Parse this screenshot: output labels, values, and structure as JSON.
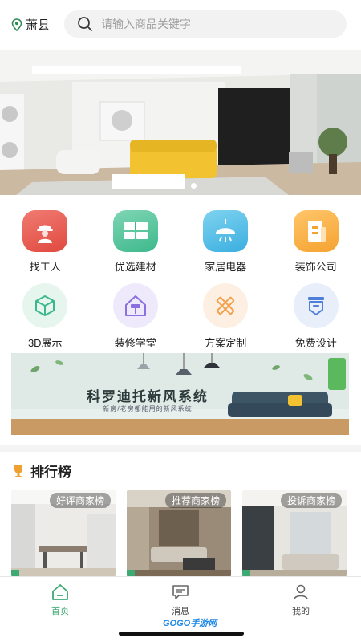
{
  "header": {
    "location": "萧县",
    "search_placeholder": "请输入商品关键字"
  },
  "banner": {
    "slides": 4,
    "active_slide": 4
  },
  "categories": [
    {
      "label": "找工人",
      "icon": "worker-icon",
      "color": "#e9564b"
    },
    {
      "label": "优选建材",
      "icon": "bricks-icon",
      "color": "#4cc097"
    },
    {
      "label": "家居电器",
      "icon": "lamp-icon",
      "color": "#45b5e3"
    },
    {
      "label": "装饰公司",
      "icon": "building-icon",
      "color": "#f7ac3c"
    },
    {
      "label": "3D展示",
      "icon": "cube-icon",
      "color": "#3db88c"
    },
    {
      "label": "装修学堂",
      "icon": "paint-roller-icon",
      "color": "#8a6fe0"
    },
    {
      "label": "方案定制",
      "icon": "ruler-pencil-icon",
      "color": "#f2a04a"
    },
    {
      "label": "免费设计",
      "icon": "design-badge-icon",
      "color": "#4f7fd9"
    }
  ],
  "ad": {
    "title": "科罗迪托新风系统",
    "subtitle": "新房/老房都能用的新风系统"
  },
  "ranking": {
    "title": "排行榜",
    "cards": [
      {
        "tag": "好评商家榜"
      },
      {
        "tag": "推荐商家榜"
      },
      {
        "tag": "投诉商家榜"
      }
    ]
  },
  "tabbar": {
    "items": [
      {
        "label": "首页",
        "icon": "home-icon"
      },
      {
        "label": "消息",
        "icon": "message-icon"
      },
      {
        "label": "我的",
        "icon": "user-icon"
      }
    ],
    "active": "首页"
  },
  "watermark": "GOGO手游网",
  "colors": {
    "accent": "#3daa74",
    "sofa": "#f2c230"
  }
}
